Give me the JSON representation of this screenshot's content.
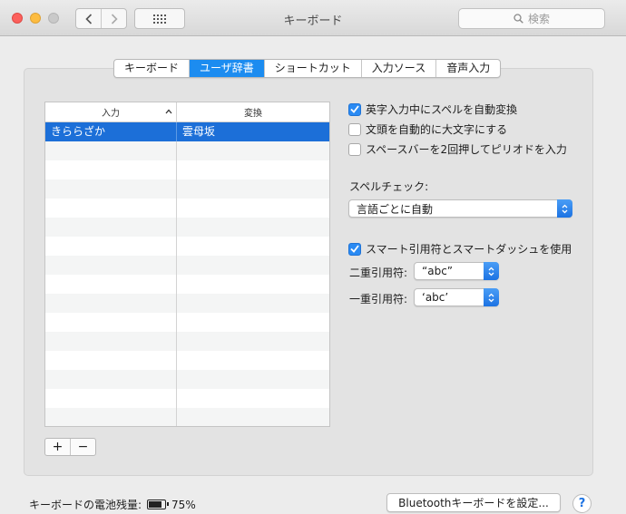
{
  "window": {
    "title": "キーボード"
  },
  "search": {
    "placeholder": "検索"
  },
  "tabs": [
    {
      "label": "キーボード",
      "active": false
    },
    {
      "label": "ユーザ辞書",
      "active": true
    },
    {
      "label": "ショートカット",
      "active": false
    },
    {
      "label": "入力ソース",
      "active": false
    },
    {
      "label": "音声入力",
      "active": false
    }
  ],
  "table": {
    "columns": [
      "入力",
      "変換"
    ],
    "rows": [
      {
        "input": "きららざか",
        "conversion": "雲母坂",
        "selected": true
      }
    ],
    "empty_rows": 15
  },
  "controls": {
    "add": "+",
    "remove": "−"
  },
  "options": {
    "autocorrect": {
      "label": "英字入力中にスペルを自動変換",
      "checked": true
    },
    "capitalize": {
      "label": "文頭を自動的に大文字にする",
      "checked": false
    },
    "period": {
      "label": "スペースバーを2回押してピリオドを入力",
      "checked": false
    },
    "spellcheck_label": "スペルチェック:",
    "spellcheck_value": "言語ごとに自動",
    "smart_quotes": {
      "label": "スマート引用符とスマートダッシュを使用",
      "checked": true
    },
    "double_quote_label": "二重引用符:",
    "double_quote_value": "“abc”",
    "single_quote_label": "一重引用符:",
    "single_quote_value": "‘abc’"
  },
  "footer": {
    "battery_label": "キーボードの電池残量:",
    "battery_value": "75%",
    "bluetooth_button": "Bluetoothキーボードを設定...",
    "help": "?"
  },
  "colors": {
    "accent": "#1c8cf0",
    "selection": "#1c6fd8"
  }
}
